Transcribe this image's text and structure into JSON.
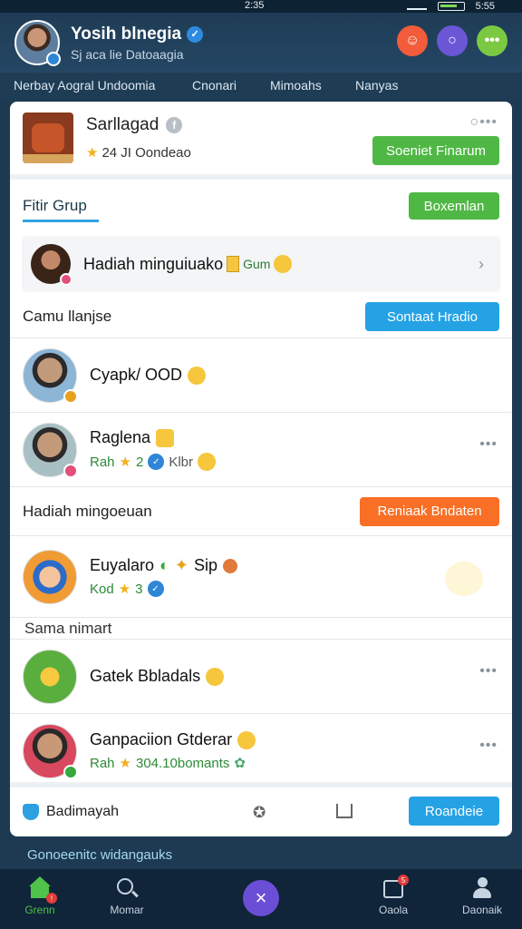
{
  "status": {
    "time": "2:35",
    "battery": "5:55"
  },
  "profile": {
    "name": "Yosih blnegia",
    "subtitle": "Sj aca lie Datoaagia"
  },
  "top_actions": {
    "colors": [
      "#f25c3b",
      "#6b57d6",
      "#7bc943"
    ]
  },
  "tabs": [
    {
      "label": "Nerbay Aogral Undoomia"
    },
    {
      "label": "Cnonari"
    },
    {
      "label": "Mimoahs"
    },
    {
      "label": "Nanyas"
    }
  ],
  "group": {
    "title": "Sarllagad",
    "meta": "24 JI Oondeao",
    "action": "Soeniet Finarum"
  },
  "fitur": {
    "title": "Fitir Grup",
    "action": "Boxemlan"
  },
  "highlight": {
    "text": "Hadiah minguiuako",
    "gum": "Gum"
  },
  "section1": {
    "title": "Camu llanjse",
    "action": "Sontaat Hradio"
  },
  "rows1": [
    {
      "name": "Cyapk/ OOD",
      "meta": ""
    },
    {
      "name": "Raglena",
      "meta_a": "Rah",
      "meta_b": "2",
      "meta_c": "Klbr"
    }
  ],
  "section2": {
    "title": "Hadiah mingoeuan",
    "action": "Reniaak Bndaten"
  },
  "rows2": [
    {
      "name": "Euyalaro",
      "extra": "Sip",
      "meta_a": "Kod",
      "meta_b": "3"
    }
  ],
  "section3": {
    "title": "Sama nimart"
  },
  "rows3": [
    {
      "name": "Gatek Bbladals"
    },
    {
      "name": "Ganpaciion Gtderar",
      "meta_a": "Rah",
      "meta_b": "304.10bomants"
    }
  ],
  "footer": {
    "label": "Badimayah",
    "action": "Roandeie"
  },
  "below_card": "Gonoeenitc widangauks",
  "nav": [
    {
      "label": "Grenn"
    },
    {
      "label": "Momar"
    },
    {
      "label": "Oaola"
    },
    {
      "label": "Daonaik"
    }
  ]
}
